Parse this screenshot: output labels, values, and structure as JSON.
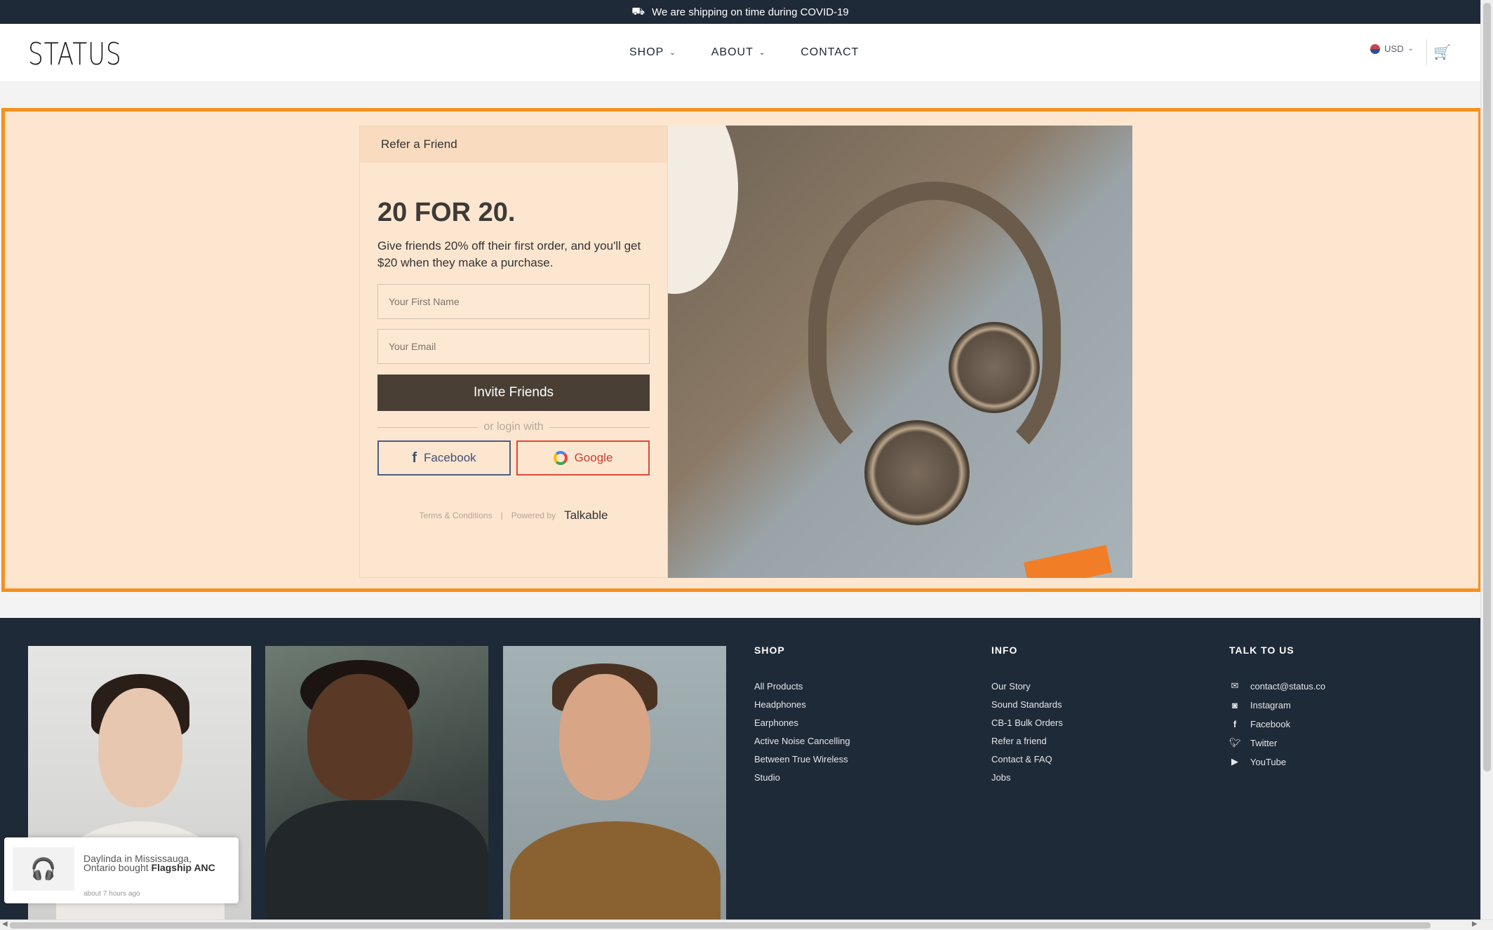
{
  "topbar": {
    "icon": "truck-icon",
    "text": "We are shipping on time during COVID-19"
  },
  "header": {
    "logo": "STATUS",
    "nav": [
      {
        "label": "SHOP",
        "has_menu": true
      },
      {
        "label": "ABOUT",
        "has_menu": true
      },
      {
        "label": "CONTACT",
        "has_menu": false
      }
    ],
    "currency": "USD"
  },
  "promo": {
    "panel_title": "Refer a Friend",
    "headline": "20 FOR 20.",
    "description": "Give friends 20% off their first order, and you'll get $20 when they make a purchase.",
    "first_name_placeholder": "Your First Name",
    "email_placeholder": "Your Email",
    "invite_label": "Invite Friends",
    "or_text": "or login with",
    "facebook_label": "Facebook",
    "google_label": "Google",
    "terms_label": "Terms & Conditions",
    "powered_by": "Powered by",
    "powered_brand": "Talkable"
  },
  "footer": {
    "shop": {
      "title": "SHOP",
      "links": [
        "All Products",
        "Headphones",
        "Earphones",
        "Active Noise Cancelling",
        "Between True Wireless",
        "Studio"
      ]
    },
    "info": {
      "title": "INFO",
      "links": [
        "Our Story",
        "Sound Standards",
        "CB-1 Bulk Orders",
        "Refer a friend",
        "Contact & FAQ",
        "Jobs"
      ]
    },
    "talk": {
      "title": "TALK TO US",
      "links": [
        {
          "icon": "mail-icon",
          "label": "contact@status.co"
        },
        {
          "icon": "instagram-icon",
          "label": "Instagram"
        },
        {
          "icon": "facebook-icon",
          "label": "Facebook"
        },
        {
          "icon": "twitter-icon",
          "label": "Twitter"
        },
        {
          "icon": "youtube-icon",
          "label": "YouTube"
        }
      ]
    }
  },
  "toast": {
    "text_prefix": "Daylinda in Mississauga, Ontario bought",
    "product": "Flagship ANC",
    "time": "about 7 hours ago"
  },
  "colors": {
    "dark_navy": "#1f2a38",
    "promo_bg": "#fde6d0",
    "promo_border": "#f6901e",
    "invite_btn": "#4a3f35",
    "facebook": "#4d5c82",
    "google": "#de4a36"
  }
}
